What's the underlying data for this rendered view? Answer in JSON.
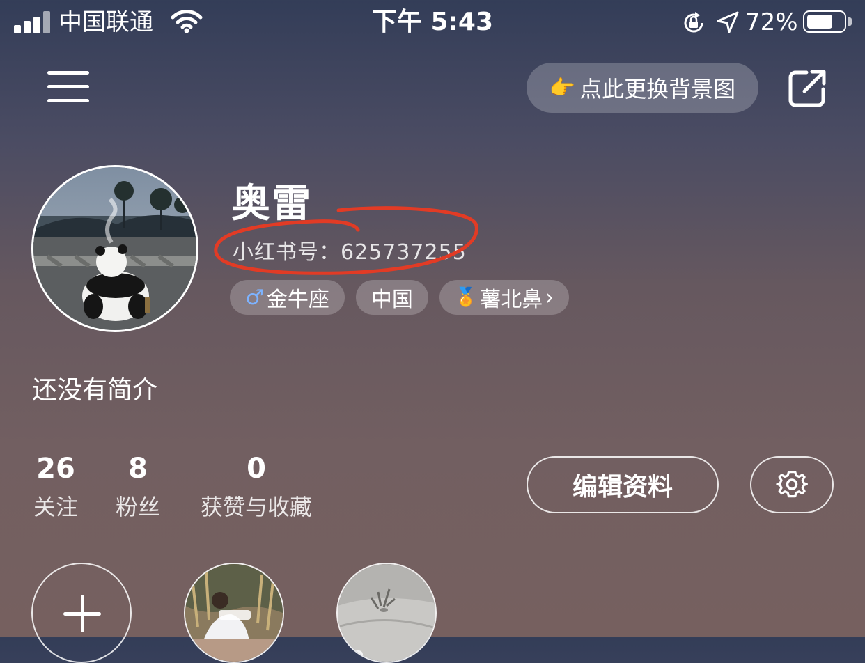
{
  "status_bar": {
    "carrier": "中国联通",
    "time": "下午 5:43",
    "battery_percent": "72%",
    "battery_level": 0.72
  },
  "header": {
    "change_background_label": "点此更换背景图",
    "icons": [
      "menu-icon",
      "share-icon"
    ]
  },
  "profile": {
    "name": "奥雷",
    "id_line": "小红书号：625737255",
    "tags": [
      {
        "prefix": "♂",
        "label": "金牛座"
      },
      {
        "prefix": "",
        "label": "中国"
      },
      {
        "prefix": "🏅",
        "label": "薯北鼻",
        "suffix": "›"
      }
    ],
    "bio": "还没有简介"
  },
  "stats": [
    {
      "value": "26",
      "label": "关注"
    },
    {
      "value": "8",
      "label": "粉丝"
    },
    {
      "value": "0",
      "label": "获赞与收藏"
    }
  ],
  "actions": {
    "edit_label": "编辑资料",
    "settings_icon": "gear-icon"
  },
  "colors": {
    "annotation_red": "#e23b25",
    "gender_blue": "#7db3ff"
  }
}
